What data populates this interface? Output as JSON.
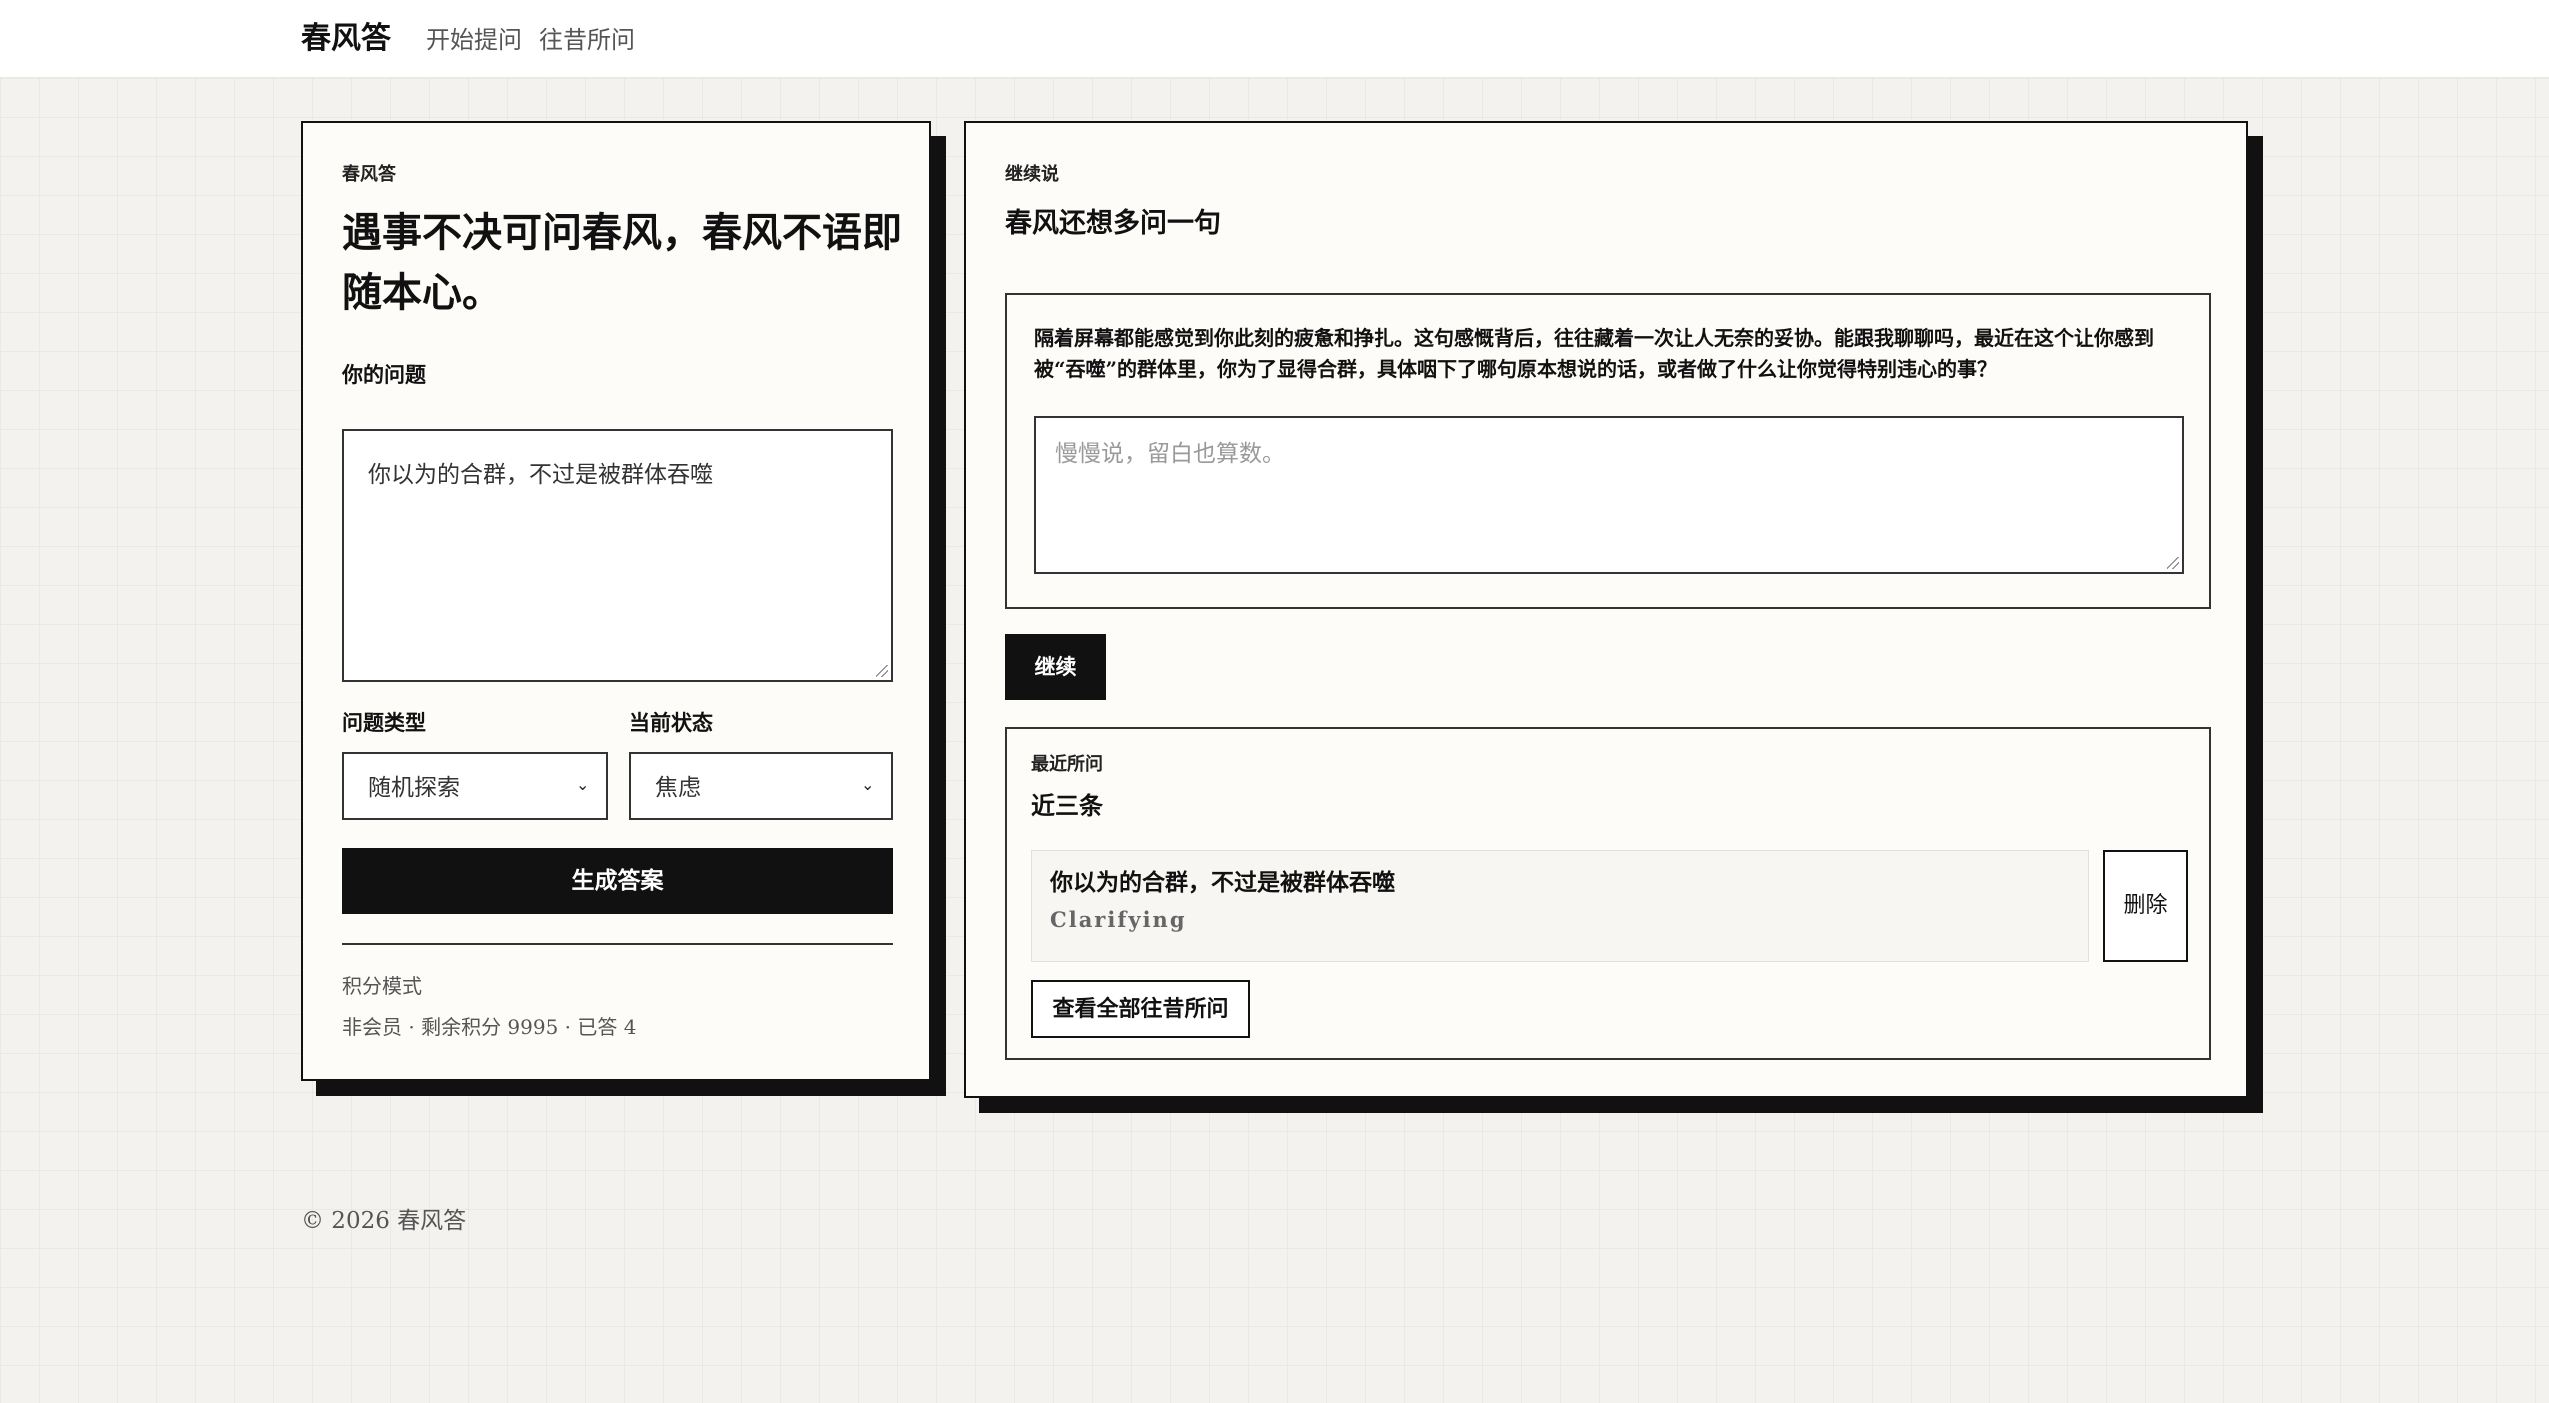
{
  "header": {
    "brand": "春风答",
    "nav": {
      "start": "开始提问",
      "history": "往昔所问"
    }
  },
  "ask_panel": {
    "eyebrow": "春风答",
    "headline": "遇事不决可问春风，春风不语即随本心。",
    "question_label": "你的问题",
    "question_value": "你以为的合群，不过是被群体吞噬",
    "type_label": "问题类型",
    "type_value": "随机探索",
    "state_label": "当前状态",
    "state_value": "焦虑",
    "generate_button": "生成答案",
    "mode_label": "积分模式",
    "mode_info": "非会员 · 剩余积分 9995 · 已答 4"
  },
  "followup_panel": {
    "eyebrow": "继续说",
    "title": "春风还想多问一句",
    "prompt": "隔着屏幕都能感觉到你此刻的疲惫和挣扎。这句感慨背后，往往藏着一次让人无奈的妥协。能跟我聊聊吗，最近在这个让你感到被“吞噬”的群体里，你为了显得合群，具体咽下了哪句原本想说的话，或者做了什么让你觉得特别违心的事？",
    "reply_placeholder": "慢慢说，留白也算数。",
    "continue_button": "继续"
  },
  "recent": {
    "eyebrow": "最近所问",
    "title": "近三条",
    "items": [
      {
        "question": "你以为的合群，不过是被群体吞噬",
        "type": "Clarifying",
        "delete_label": "删除"
      }
    ],
    "view_all_button": "查看全部往昔所问"
  },
  "footer": {
    "text": "© 2026 春风答"
  },
  "colors": {
    "ink": "#111111",
    "paper": "#fdfcf8",
    "background": "#f3f2ee"
  }
}
